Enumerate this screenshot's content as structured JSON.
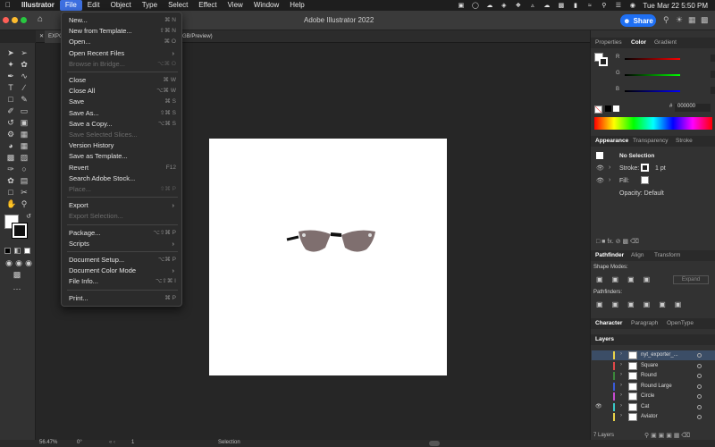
{
  "menubar": {
    "app": "Illustrator",
    "items": [
      "File",
      "Edit",
      "Object",
      "Type",
      "Select",
      "Effect",
      "View",
      "Window",
      "Help"
    ],
    "clock": "Tue Mar 22  5:50 PM"
  },
  "titlebar": {
    "title": "Adobe Illustrator 2022",
    "share": "Share"
  },
  "tab": {
    "left": "EXPO",
    "right": "GB/Preview)"
  },
  "file_menu": [
    {
      "label": "New...",
      "shortcut": "⌘ N",
      "enabled": true
    },
    {
      "label": "New from Template...",
      "shortcut": "⇧⌘ N",
      "enabled": true
    },
    {
      "label": "Open...",
      "shortcut": "⌘ O",
      "enabled": true
    },
    {
      "label": "Open Recent Files",
      "shortcut": "",
      "submenu": true,
      "enabled": true
    },
    {
      "label": "Browse in Bridge...",
      "shortcut": "⌥⌘ O",
      "enabled": false
    },
    {
      "sep": true
    },
    {
      "label": "Close",
      "shortcut": "⌘ W",
      "enabled": true
    },
    {
      "label": "Close All",
      "shortcut": "⌥⌘ W",
      "enabled": true
    },
    {
      "label": "Save",
      "shortcut": "⌘ S",
      "enabled": true
    },
    {
      "label": "Save As...",
      "shortcut": "⇧⌘ S",
      "enabled": true
    },
    {
      "label": "Save a Copy...",
      "shortcut": "⌥⌘ S",
      "enabled": true
    },
    {
      "label": "Save Selected Slices...",
      "shortcut": "",
      "enabled": false
    },
    {
      "label": "Version History",
      "shortcut": "",
      "enabled": true
    },
    {
      "label": "Save as Template...",
      "shortcut": "",
      "enabled": true
    },
    {
      "label": "Revert",
      "shortcut": "F12",
      "enabled": true
    },
    {
      "label": "Search Adobe Stock...",
      "shortcut": "",
      "enabled": true
    },
    {
      "label": "Place...",
      "shortcut": "⇧⌘ P",
      "enabled": false
    },
    {
      "sep": true
    },
    {
      "label": "Export",
      "shortcut": "",
      "submenu": true,
      "enabled": true
    },
    {
      "label": "Export Selection...",
      "shortcut": "",
      "enabled": false
    },
    {
      "sep": true
    },
    {
      "label": "Package...",
      "shortcut": "⌥⇧⌘ P",
      "enabled": true
    },
    {
      "label": "Scripts",
      "shortcut": "",
      "submenu": true,
      "enabled": true
    },
    {
      "sep": true
    },
    {
      "label": "Document Setup...",
      "shortcut": "⌥⌘ P",
      "enabled": true
    },
    {
      "label": "Document Color Mode",
      "shortcut": "",
      "submenu": true,
      "enabled": true
    },
    {
      "label": "File Info...",
      "shortcut": "⌥⇧⌘ I",
      "enabled": true
    },
    {
      "sep": true
    },
    {
      "label": "Print...",
      "shortcut": "⌘ P",
      "enabled": true
    }
  ],
  "color_panel": {
    "tabs": [
      "Properties",
      "Color",
      "Gradient"
    ],
    "active_tab": "Color",
    "channels": [
      {
        "name": "R",
        "value": "0",
        "color": "#d13b3b"
      },
      {
        "name": "G",
        "value": "0",
        "color": "#3bbf3b"
      },
      {
        "name": "B",
        "value": "0",
        "color": "#3b5bd1"
      }
    ],
    "hex": "000000"
  },
  "appearance_panel": {
    "tabs": [
      "Appearance",
      "Transparency",
      "Stroke"
    ],
    "title": "No Selection",
    "stroke_label": "Stroke:",
    "stroke_value": "1 pt",
    "fill_label": "Fill:",
    "opacity": "Opacity: Default"
  },
  "pathfinder_panel": {
    "tabs": [
      "Pathfinder",
      "Align",
      "Transform"
    ],
    "shape_modes": "Shape Modes:",
    "expand": "Expand",
    "pathfinders": "Pathfinders:"
  },
  "character_tabs": [
    "Character",
    "Paragraph",
    "OpenType"
  ],
  "layers_panel": {
    "title": "Layers",
    "layers": [
      {
        "name": "nyt_exporter_...",
        "color": "#e8d34a",
        "visible": false,
        "selected": true
      },
      {
        "name": "Square",
        "color": "#e04848",
        "visible": false
      },
      {
        "name": "Round",
        "color": "#3a8a3a",
        "visible": false
      },
      {
        "name": "Round Large",
        "color": "#3a5ad8",
        "visible": false
      },
      {
        "name": "Circle",
        "color": "#c64ad0",
        "visible": false
      },
      {
        "name": "Cat",
        "color": "#3ac8c8",
        "visible": true
      },
      {
        "name": "Aviator",
        "color": "#e8d34a",
        "visible": false
      }
    ],
    "count": "7 Layers"
  },
  "status": {
    "zoom": "56.47%",
    "rotation": "0°",
    "artboard": "1",
    "mode": "Selection"
  }
}
